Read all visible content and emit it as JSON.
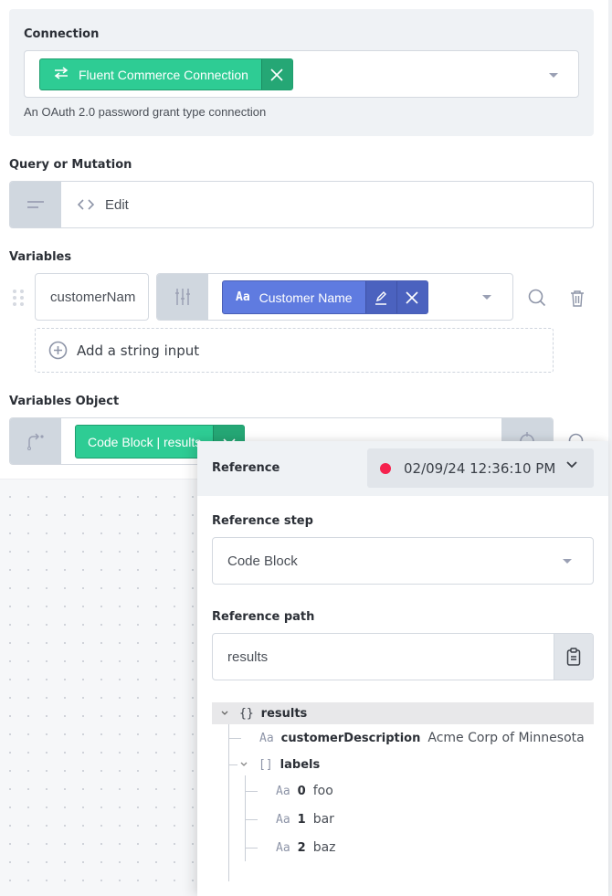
{
  "connection": {
    "label": "Connection",
    "selected_chip": "Fluent Commerce Connection",
    "chip_icon": "swap-arrows-icon",
    "description": "An OAuth 2.0 password grant type connection"
  },
  "query": {
    "label": "Query or Mutation",
    "edit_label": "Edit"
  },
  "variables": {
    "label": "Variables",
    "rows": [
      {
        "name_value": "customerNam",
        "value_chip": "Customer Name",
        "value_type_icon": "text-type-icon"
      }
    ],
    "add_label": "Add a string input"
  },
  "variables_object": {
    "label": "Variables Object",
    "chip": "Code Block | results"
  },
  "reference_popover": {
    "title": "Reference",
    "run_timestamp": "02/09/24 12:36:10 PM",
    "run_status_color": "#f5224e",
    "step_label": "Reference step",
    "step_value": "Code Block",
    "path_label": "Reference path",
    "path_value": "results",
    "tree": {
      "root": {
        "type_icon": "{}",
        "key": "results"
      },
      "children": [
        {
          "type_icon": "Aa",
          "key": "customerDescription",
          "value": "Acme Corp of Minnesota"
        },
        {
          "type_icon": "[]",
          "key": "labels",
          "items": [
            {
              "type_icon": "Aa",
              "key": "0",
              "value": "foo"
            },
            {
              "type_icon": "Aa",
              "key": "1",
              "value": "bar"
            },
            {
              "type_icon": "Aa",
              "key": "2",
              "value": "baz"
            }
          ]
        }
      ]
    }
  },
  "colors": {
    "green_chip": "#2ecc94",
    "blue_chip": "#5f7be0",
    "panel_bg": "#eff2f5"
  }
}
